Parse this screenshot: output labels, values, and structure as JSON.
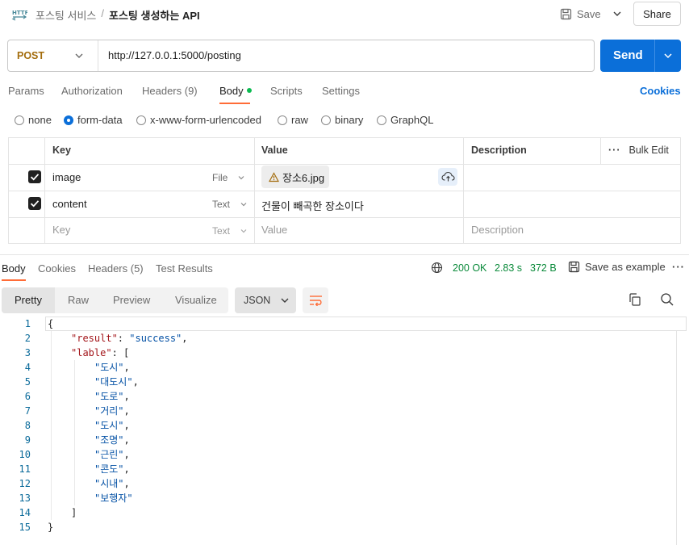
{
  "header": {
    "icon_name": "http-icon",
    "breadcrumb_parent": "포스팅 서비스",
    "breadcrumb_sep": "/",
    "breadcrumb_current": "포스팅 생성하는 API",
    "save_label": "Save",
    "share_label": "Share"
  },
  "request": {
    "method": "POST",
    "url": "http://127.0.0.1:5000/posting",
    "send_label": "Send",
    "tabs": [
      {
        "label": "Params"
      },
      {
        "label": "Authorization"
      },
      {
        "label": "Headers (9)"
      },
      {
        "label": "Body"
      },
      {
        "label": "Scripts"
      },
      {
        "label": "Settings"
      }
    ],
    "active_tab": "Body",
    "cookies_label": "Cookies",
    "body_types": [
      "none",
      "form-data",
      "x-www-form-urlencoded",
      "raw",
      "binary",
      "GraphQL"
    ],
    "selected_body_type": "form-data"
  },
  "form_table": {
    "headers": {
      "key": "Key",
      "value": "Value",
      "description": "Description",
      "bulk_edit": "Bulk Edit"
    },
    "rows": [
      {
        "checked": true,
        "key": "image",
        "type": "File",
        "value": "장소6.jpg"
      },
      {
        "checked": true,
        "key": "content",
        "type": "Text",
        "value": "건물이 빼곡한 장소이다"
      }
    ],
    "placeholder": {
      "key": "Key",
      "type": "Text",
      "value": "Value",
      "description": "Description"
    }
  },
  "response": {
    "tabs": [
      {
        "label": "Body"
      },
      {
        "label": "Cookies"
      },
      {
        "label": "Headers (5)"
      },
      {
        "label": "Test Results"
      }
    ],
    "status": "200 OK",
    "time": "2.83 s",
    "size": "372 B",
    "save_example_label": "Save as example",
    "view_modes": [
      "Pretty",
      "Raw",
      "Preview",
      "Visualize"
    ],
    "active_view": "Pretty",
    "format": "JSON",
    "code_lines": [
      {
        "n": "1",
        "indent": 0,
        "parts": [
          [
            "p",
            "{"
          ]
        ]
      },
      {
        "n": "2",
        "indent": 1,
        "parts": [
          [
            "k",
            "\"result\""
          ],
          [
            "p",
            ": "
          ],
          [
            "s",
            "\"success\""
          ],
          [
            "p",
            ","
          ]
        ]
      },
      {
        "n": "3",
        "indent": 1,
        "parts": [
          [
            "k",
            "\"lable\""
          ],
          [
            "p",
            ": ["
          ]
        ]
      },
      {
        "n": "4",
        "indent": 2,
        "parts": [
          [
            "s",
            "\"도시\""
          ],
          [
            "p",
            ","
          ]
        ]
      },
      {
        "n": "5",
        "indent": 2,
        "parts": [
          [
            "s",
            "\"대도시\""
          ],
          [
            "p",
            ","
          ]
        ]
      },
      {
        "n": "6",
        "indent": 2,
        "parts": [
          [
            "s",
            "\"도로\""
          ],
          [
            "p",
            ","
          ]
        ]
      },
      {
        "n": "7",
        "indent": 2,
        "parts": [
          [
            "s",
            "\"거리\""
          ],
          [
            "p",
            ","
          ]
        ]
      },
      {
        "n": "8",
        "indent": 2,
        "parts": [
          [
            "s",
            "\"도시\""
          ],
          [
            "p",
            ","
          ]
        ]
      },
      {
        "n": "9",
        "indent": 2,
        "parts": [
          [
            "s",
            "\"조명\""
          ],
          [
            "p",
            ","
          ]
        ]
      },
      {
        "n": "10",
        "indent": 2,
        "parts": [
          [
            "s",
            "\"근린\""
          ],
          [
            "p",
            ","
          ]
        ]
      },
      {
        "n": "11",
        "indent": 2,
        "parts": [
          [
            "s",
            "\"콘도\""
          ],
          [
            "p",
            ","
          ]
        ]
      },
      {
        "n": "12",
        "indent": 2,
        "parts": [
          [
            "s",
            "\"시내\""
          ],
          [
            "p",
            ","
          ]
        ]
      },
      {
        "n": "13",
        "indent": 2,
        "parts": [
          [
            "s",
            "\"보행자\""
          ]
        ]
      },
      {
        "n": "14",
        "indent": 1,
        "parts": [
          [
            "p",
            "]"
          ]
        ]
      },
      {
        "n": "15",
        "indent": 0,
        "parts": [
          [
            "p",
            "}"
          ]
        ]
      }
    ]
  },
  "colors": {
    "accent_orange": "#ff6c37",
    "send_blue": "#0b6fd9",
    "status_green": "#0a8a3a",
    "json_key": "#a3161b",
    "json_string": "#0451a5",
    "method_post": "#a36c0c"
  }
}
